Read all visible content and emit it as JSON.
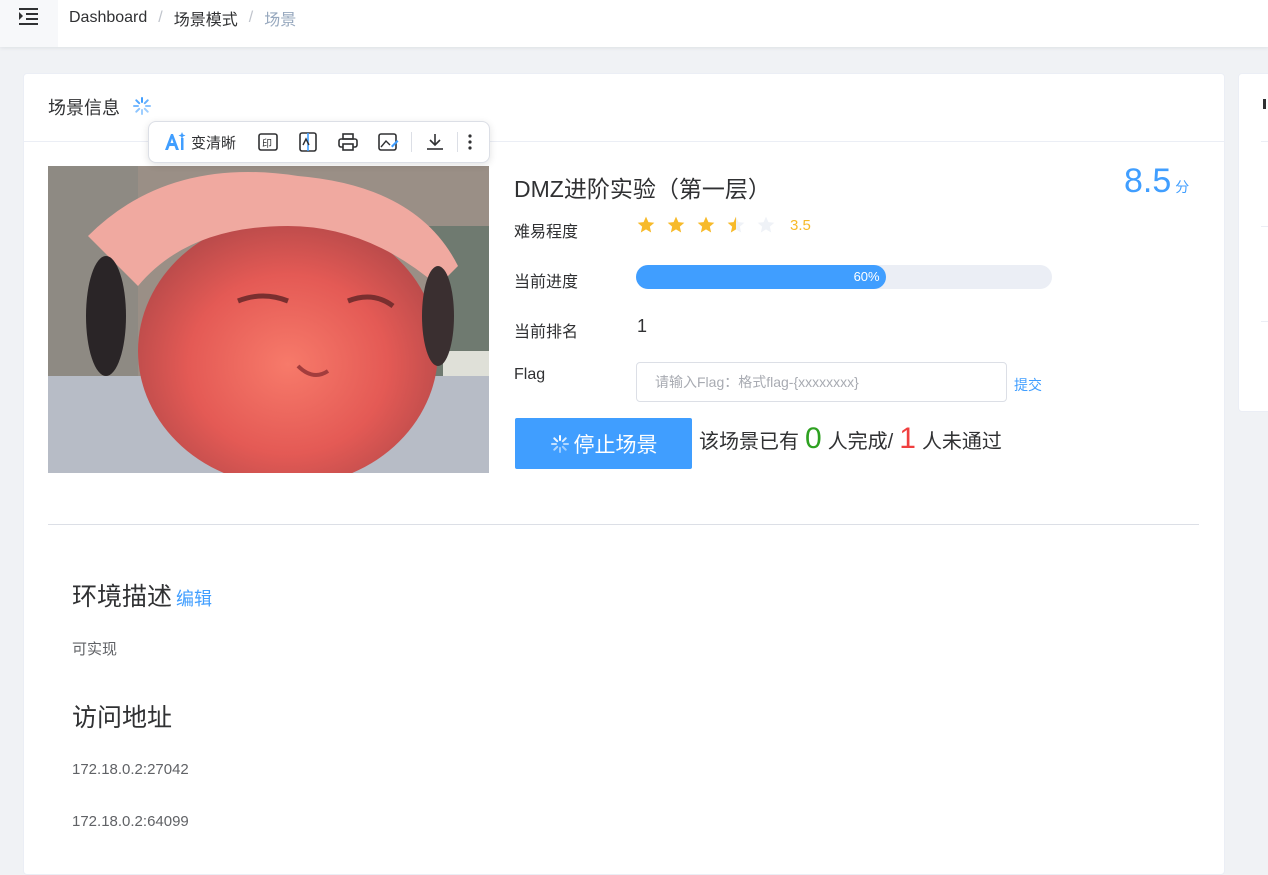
{
  "breadcrumb": [
    {
      "label": "Dashboard"
    },
    {
      "label": "场景模式"
    },
    {
      "label": "场景"
    }
  ],
  "separator": "/",
  "card": {
    "title": "场景信息"
  },
  "image_toolbar": {
    "enhance_label": "变清晰",
    "items": [
      "ai-enhance-icon",
      "ocr-text-icon",
      "translate-icon",
      "print-icon",
      "edit-image-icon",
      "download-icon",
      "more-icon"
    ]
  },
  "scene": {
    "name": "DMZ进阶实验（第一层）",
    "score": "8.5",
    "score_unit": "分",
    "difficulty_label": "难易程度",
    "rating": 3.5,
    "rating_text": "3.5",
    "progress_label": "当前进度",
    "progress_percent": 60,
    "progress_text": "60%",
    "rank_label": "当前排名",
    "rank_value": "1",
    "flag_label": "Flag",
    "flag_placeholder": "请输入Flag：格式flag-{xxxxxxxx}",
    "flag_value": "",
    "submit_label": "提交",
    "stop_button_label": "停止场景",
    "completion_prefix": "该场景已有",
    "completed_count": "0",
    "completion_mid": "人完成/",
    "failed_count": "1",
    "completion_suffix": "人未通过"
  },
  "description": {
    "title": "环境描述",
    "edit_label": "编辑",
    "text": "可实现"
  },
  "access": {
    "title": "访问地址",
    "addresses": [
      "172.18.0.2:27042",
      "172.18.0.2:64099"
    ]
  },
  "colors": {
    "primary": "#409eff",
    "success": "#2ea121",
    "danger": "#f03f3f",
    "star": "#f7ba2a"
  }
}
